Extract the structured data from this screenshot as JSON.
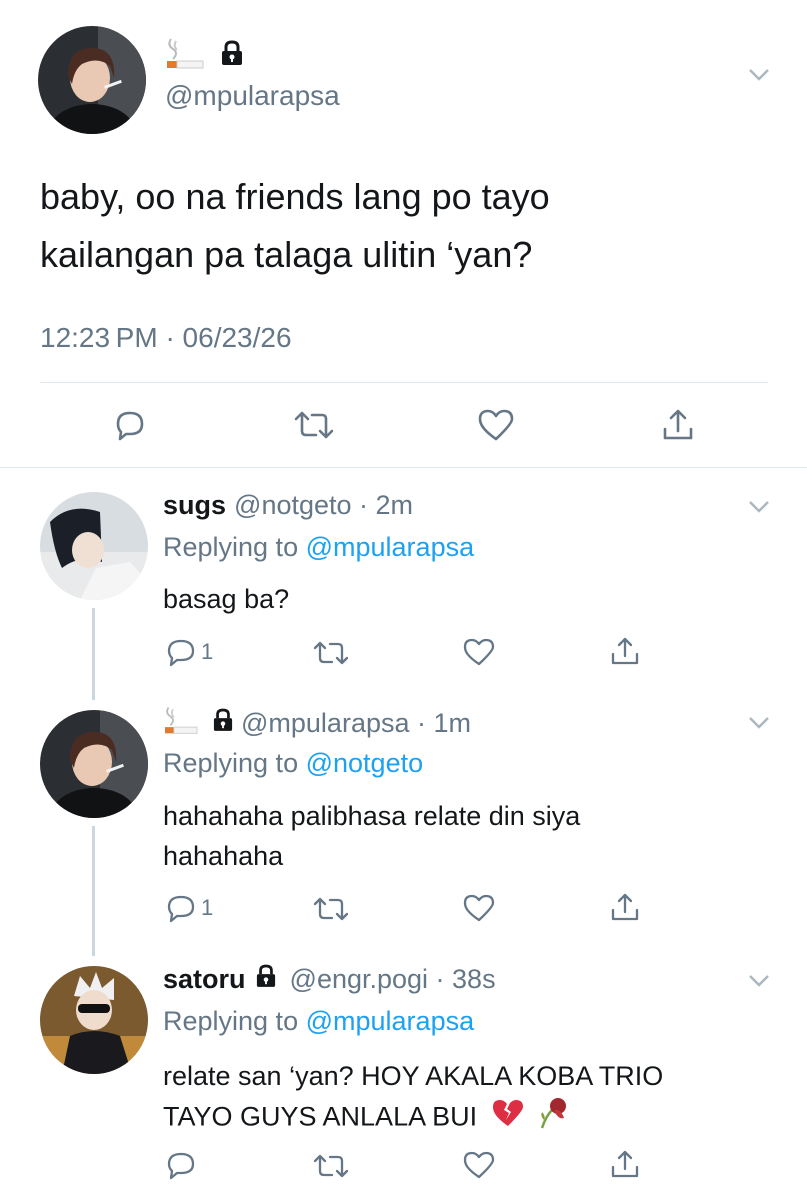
{
  "main_tweet": {
    "handle": "@mpularapsa",
    "text_line1": "baby, oo na friends lang po tayo",
    "text_line2": "kailangan pa talaga ulitin ‘yan?",
    "timestamp": "12:23 PM · 06/23/26"
  },
  "replies": [
    {
      "name": "sugs",
      "meta": "@notgeto · 2m",
      "replying_label": "Replying to",
      "replying_to": "@mpularapsa",
      "text": "basag ba?",
      "reply_count": "1"
    },
    {
      "name": "",
      "meta": "@mpularapsa · 1m",
      "replying_label": "Replying to",
      "replying_to": "@notgeto",
      "text_line1": "hahahaha palibhasa relate din siya",
      "text_line2": "hahahaha",
      "reply_count": "1"
    },
    {
      "name": "satoru",
      "meta": "@engr.pogi · 38s",
      "replying_label": "Replying to",
      "replying_to": "@mpularapsa",
      "text_line1": "relate san ‘yan? HOY AKALA KOBA TRIO",
      "text_line2": "TAYO GUYS ANLALA BUI",
      "reply_count": ""
    }
  ],
  "icons": {
    "name_emoji": "cigarette-emoji",
    "protected": "lock-icon",
    "reply": "reply-icon",
    "retweet": "retweet-icon",
    "like": "heart-icon",
    "share": "share-icon",
    "more": "chevron-down-icon"
  },
  "colors": {
    "text": "#14171a",
    "secondary": "#657786",
    "link": "#1da1f2",
    "divider": "#e1e8ed"
  }
}
